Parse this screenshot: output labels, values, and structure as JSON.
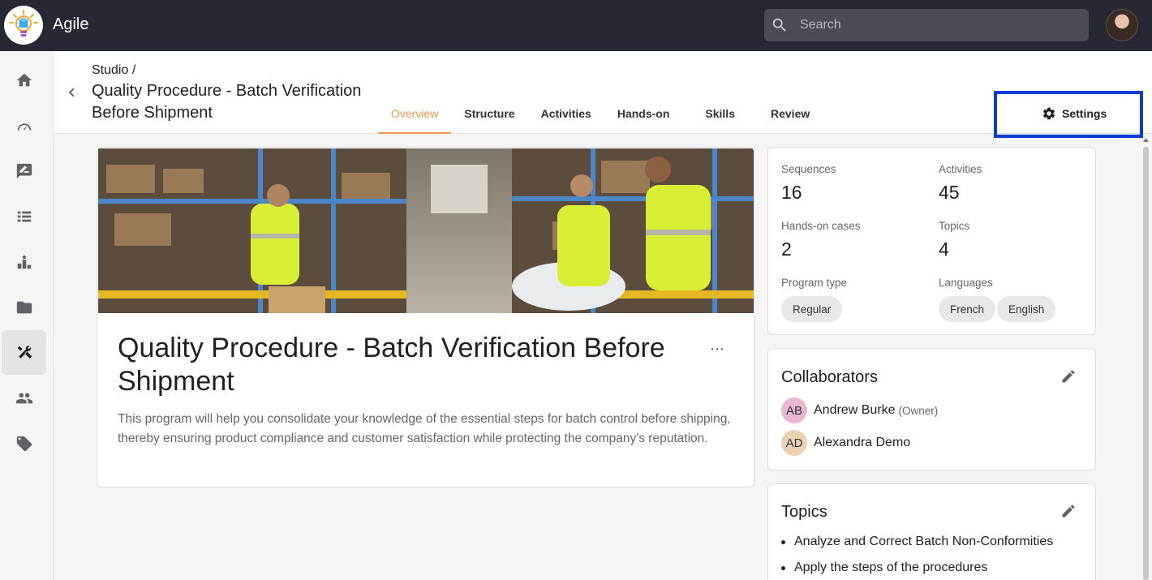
{
  "app": {
    "title": "Agile"
  },
  "search": {
    "placeholder": "Search"
  },
  "sidebar": {
    "items": [
      {
        "icon": "home-icon"
      },
      {
        "icon": "dashboard-icon"
      },
      {
        "icon": "rate-review-icon"
      },
      {
        "icon": "list-icon"
      },
      {
        "icon": "leaderboard-icon"
      },
      {
        "icon": "folder-icon"
      },
      {
        "icon": "build-tools-icon",
        "active": true
      },
      {
        "icon": "people-icon"
      },
      {
        "icon": "tag-icon"
      }
    ]
  },
  "header": {
    "breadcrumb": "Studio /",
    "title": "Quality Procedure - Batch Verification Before Shipment",
    "tabs": [
      {
        "label": "Overview",
        "active": true
      },
      {
        "label": "Structure"
      },
      {
        "label": "Activities"
      },
      {
        "label": "Hands-on"
      },
      {
        "label": "Skills"
      },
      {
        "label": "Review"
      }
    ],
    "settings_label": "Settings"
  },
  "program": {
    "title": "Quality Procedure - Batch Verification Before Shipment",
    "more_label": "⋯",
    "description": "This program will help you consolidate your knowledge of the essential steps for batch control before shipping, thereby ensuring product compliance and customer satisfaction while protecting the company's reputation."
  },
  "stats": {
    "sequences_label": "Sequences",
    "sequences_value": "16",
    "activities_label": "Activities",
    "activities_value": "45",
    "handson_label": "Hands-on cases",
    "handson_value": "2",
    "topics_label": "Topics",
    "topics_value": "4",
    "program_type_label": "Program type",
    "program_type_value": "Regular",
    "languages_label": "Languages",
    "languages": [
      "French",
      "English"
    ]
  },
  "collaborators": {
    "title": "Collaborators",
    "people": [
      {
        "initials": "AB",
        "name": "Andrew Burke",
        "role": "(Owner)",
        "color": "#eab7d2"
      },
      {
        "initials": "AD",
        "name": "Alexandra Demo",
        "role": "",
        "color": "#ecd2b4"
      }
    ]
  },
  "topics": {
    "title": "Topics",
    "items": [
      "Analyze and Correct Batch Non-Conformities",
      "Apply the steps of the procedures"
    ]
  },
  "colors": {
    "topbar": "#262833",
    "accent_tab": "#f29651",
    "highlight_border": "#0a3cd6"
  }
}
